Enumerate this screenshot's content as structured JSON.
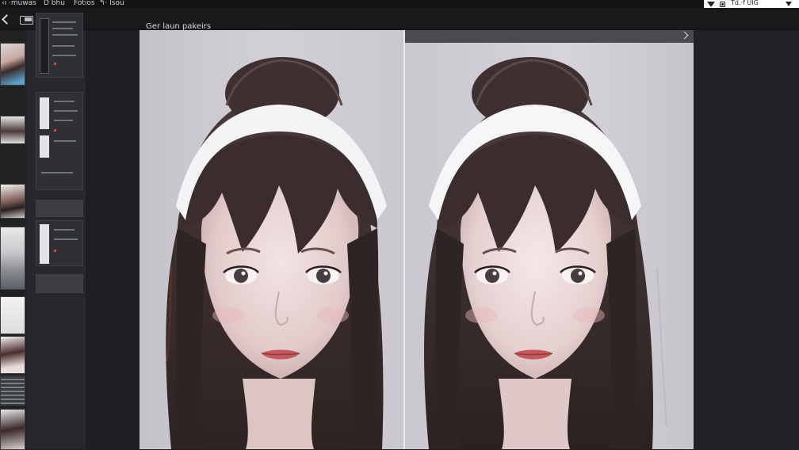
{
  "menubar": {
    "items": [
      "‹i ·muwas",
      "D bhu",
      "Fotios",
      "↰· lsou"
    ],
    "status": "Td.·f UIG"
  },
  "toolbar": {
    "title": "Ger laun pakeirs"
  },
  "icons": {
    "back": "chevron-left-icon",
    "panel": "panel-toggle-icon",
    "play": "triangle-down-icon",
    "record": "record-icon",
    "dropdown": "chevron-down-icon",
    "next": "chevron-right-icon"
  },
  "filmstrip": {
    "thumb_count": 9,
    "panel_count": 5
  },
  "colors": {
    "background": "#1f2023",
    "canvas": "#d2d0d6",
    "hair": "#3a2d2c",
    "headband": "#f4f4f6",
    "skin": "#ead6d6",
    "lips": "#c4585c"
  }
}
